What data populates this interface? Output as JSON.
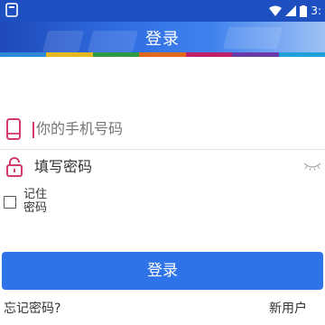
{
  "status_bar": {
    "time": "3:"
  },
  "header": {
    "title": "登录"
  },
  "stripe_colors": [
    "#2e8ad8",
    "#e8b820",
    "#2e9a46",
    "#e06a1c",
    "#c0206a",
    "#6a3aa8",
    "#20a0d8"
  ],
  "phone": {
    "placeholder": "你的手机号码",
    "icon": "phone-icon"
  },
  "password": {
    "value": "填写密码",
    "icon": "lock-icon",
    "toggle_icon": "eye-closed-icon"
  },
  "remember": {
    "label": "记住密码",
    "checked": false
  },
  "login_button": {
    "label": "登录"
  },
  "links": {
    "forgot": "忘记密码?",
    "new_user": "新用户"
  },
  "colors": {
    "primary": "#2f73e8",
    "accent": "#d43a6b"
  }
}
